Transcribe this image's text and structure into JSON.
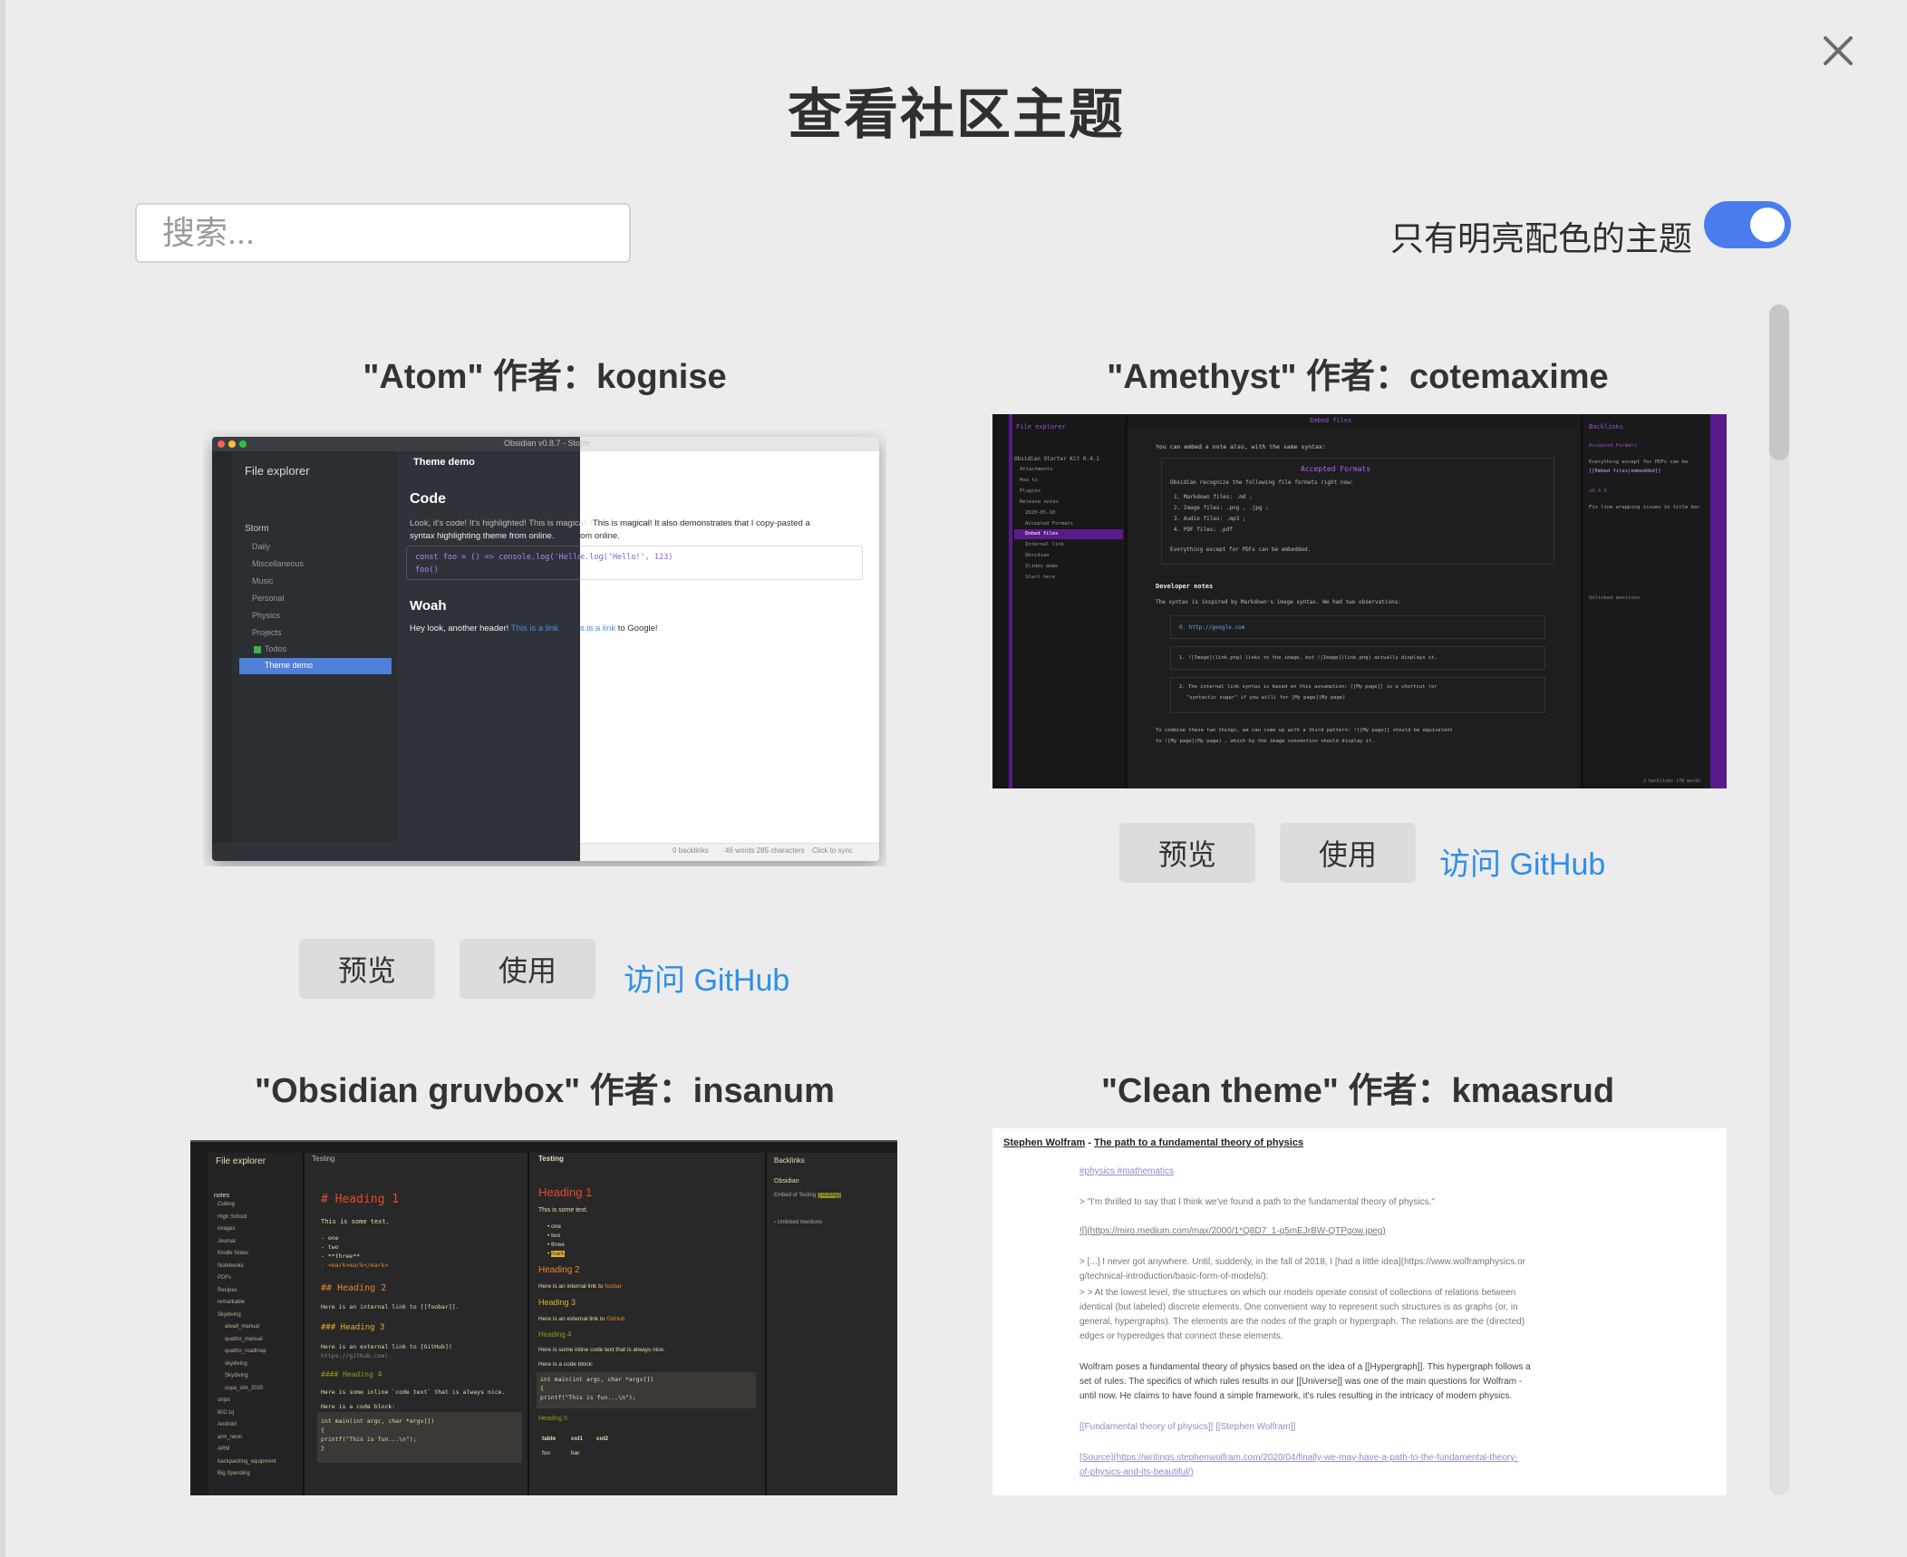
{
  "dialog": {
    "title": "查看社区主题",
    "search_placeholder": "搜索...",
    "toggle_label": "只有明亮配色的主题",
    "toggle_on": true
  },
  "themes": [
    {
      "title": "\"Atom\" 作者：kognise",
      "preview_label": "预览",
      "use_label": "使用",
      "github_label": "访问 GitHub",
      "screenshot": {
        "window_title": "Obsidian v0.8.7 - Storm",
        "sidebar_title": "File explorer",
        "folder": "Storm",
        "items": [
          "Daily",
          "Miscellaneous",
          "Music",
          "Personal",
          "Physics",
          "Projects",
          "Todos",
          "Theme demo"
        ],
        "tab_title": "Theme demo",
        "h_code": "Code",
        "p1": "Look, it's code! It's highlighted! This is magical! It also demonstrates that I copy-pasted a",
        "p2": "syntax highlighting theme from online.",
        "code1": "const foo = () => console.log('Hello!', 123)",
        "code2": "foo()",
        "h_woah": "Woah",
        "p3_a": "Hey look, another header! ",
        "p3_link": "This is a link",
        "p3_b": " to Google!",
        "status": [
          "0 backlinks",
          "46 words  285 characters",
          "Click to sync"
        ]
      }
    },
    {
      "title": "\"Amethyst\" 作者：cotemaxime",
      "preview_label": "预览",
      "use_label": "使用",
      "github_label": "访问 GitHub",
      "screenshot": {
        "sidebar_title": "File explorer",
        "vault": "Obsidian Starter Kit 0.4.1",
        "items": [
          "Attachments",
          "How to",
          "Plugins",
          "Release notes",
          "2020-05-10",
          "Accepted Formats",
          "Embed files",
          "Internal link",
          "Obsidian",
          "Slides demo",
          "Start here"
        ],
        "tab_title": "Embed files",
        "intro": "You can embed a note also, with the same syntax:",
        "embed_heading": "Accepted Formats",
        "embed_text": "Obsidian recognize the following file formats right now:",
        "formats": [
          "1. Markdown files: .md ;",
          "2. Image files: .png , .jpg ;",
          "3. Audio files: .mp3 ;",
          "4. PDF files: .pdf"
        ],
        "pdf_note": "Everything except for PDFs can be embedded.",
        "dev_heading": "Developer notes",
        "dev_text": "The syntax is inspired by Markdown's image syntax. We had two observations:",
        "url": "0. http://google.com",
        "note1": "1. ![Image](link.png) links to the image, but ![Image](link.png) actually displays it.",
        "note2a": "2. The internal link syntax is based on this assumption: [[My page]] is a shortcut (or",
        "note2b": "\"syntactic sugar\" if you will) for [My page](My page)",
        "combine_a": "To combine these two things, we can come up with a third pattern: ![[My page]] should be equivalent",
        "combine_b": "to ![My page](My page) , which by the image convention should display it.",
        "backlinks_title": "Backlinks",
        "bl_1": "Accepted Formats",
        "bl_2": "Everything except for PDFs can be",
        "bl_3": "[[Embed files|embedded]]",
        "bl_4": "v0.4.0",
        "bl_5": "Fix line wrapping issues in title bar",
        "bl_6": "Unlinked mentions",
        "bl_status": "2 backlinks   178 words"
      }
    },
    {
      "title": "\"Obsidian gruvbox\" 作者：insanum",
      "screenshot": {
        "sidebar_title": "File explorer",
        "root": "notes",
        "items": [
          "Cubing",
          "High School",
          "images",
          "Journal",
          "Kindle Notes",
          "Notebooks",
          "PDFs",
          "Recipes",
          "remarkable",
          "Skydiving",
          "aiwall_manual",
          "quattro_manual",
          "quattro_roadmap",
          "skydiving",
          "Skydiving",
          "uspa_sim_2020",
          "snips",
          "802.1q",
          "Android",
          "arm_neon",
          "ARM",
          "backpacking_equipment",
          "Big Spending"
        ],
        "tab_left": "Testing",
        "tab_right": "Testing",
        "h1_raw": "# Heading 1",
        "text": "This is some text.",
        "list": [
          "- one",
          "- two",
          "- **three**",
          "- <mark>mark</mark>"
        ],
        "h2_raw": "## Heading 2",
        "l2": "Here is an internal link to [[foobar]].",
        "h3_raw": "### Heading 3",
        "l3a": "Here is an external link to [GitHub](",
        "l3b": "https://github.com).",
        "h4_raw": "#### Heading 4",
        "l4": "Here is some inline `code text` that is always nice.",
        "l5": "Here is a code block:",
        "code": [
          "int main(int argc, char *argv[])",
          "{",
          "    printf(\"This is fun...\\n\");",
          "}"
        ],
        "r_h1": "Heading 1",
        "r_text": "This is some text.",
        "r_list": [
          "one",
          "two",
          "three",
          "mark"
        ],
        "r_h2": "Heading 2",
        "r_l2a": "Here is an internal link to ",
        "r_l2b": "foobar",
        "r_h3": "Heading 3",
        "r_l3a": "Here is an external link to ",
        "r_l3b": "GitHub",
        "r_h4": "Heading 4",
        "r_l4": "Here is some inline  code text  that is always nice.",
        "r_l5": "Here is a code block:",
        "r_h5": "Heading 5",
        "table_header": [
          "table",
          "col1",
          "col2"
        ],
        "table_row": [
          "foo",
          "bar"
        ],
        "backlinks": "Backlinks",
        "bl_obs": "Obsidian",
        "bl_embed": "Embed of Testing",
        "bl_tag": "[[Testing]]",
        "bl_unlinked": "Unlinked mentions"
      }
    },
    {
      "title": "\"Clean theme\" 作者：kmaasrud",
      "screenshot": {
        "header_a": "Stephen Wolfram",
        "header_sep": " - ",
        "header_b": "The path to a fundamental theory of physics",
        "tags": "#physics #mathematics",
        "quote": "> \"I'm thrilled to say that I think we've found a path to the fundamental theory of physics.\"",
        "img": "![](https://miro.medium.com/max/2000/1*Q8D7_1-q5mEJrBW-QTPgow.jpeg)",
        "p1a": "> [...] I never got anywhere. Until, suddenly, in the fall of 2018, I [had a little idea](https://www.wolframphysics.or",
        "p1b": "g/technical-introduction/basic-form-of-models/):",
        "p2a": "> > At the lowest level, the structures on which our models operate consist of collections of relations between",
        "p2b": "identical (but labeled) discrete elements. One convenient way to represent such structures is as graphs (or, in",
        "p2c": "general, hypergraphs). The elements are the nodes of the graph or hypergraph. The relations are the (directed)",
        "p2d": "edges or hyperedges that connect these elements.",
        "p3a": "Wolfram poses a fundamental theory of physics based on the idea of a [[Hypergraph]]. This hypergraph follows a",
        "p3b": "set of rules. The specifics of which rules results in our [[Universe]] was one of the main questions for Wolfram -",
        "p3c": "until now. He claims to have found a simple framework, it's rules resulting in the intricacy of modern physics.",
        "links": "[[Fundamental theory of physics]] [[Stephen Wolfram]]",
        "src_a": "[Source](https://writings.stephenwolfram.com/2020/04/finally-we-may-have-a-path-to-the-fundamental-theory-",
        "src_b": "of-physics-and-its-beautiful/)"
      }
    }
  ],
  "colors": {
    "accent": "#4a7cf0",
    "link": "#2f8fe8",
    "amethyst_purple": "#5b1a8a",
    "gruvbox_red": "#e84a2a",
    "gruvbox_orange": "#e8862a"
  }
}
